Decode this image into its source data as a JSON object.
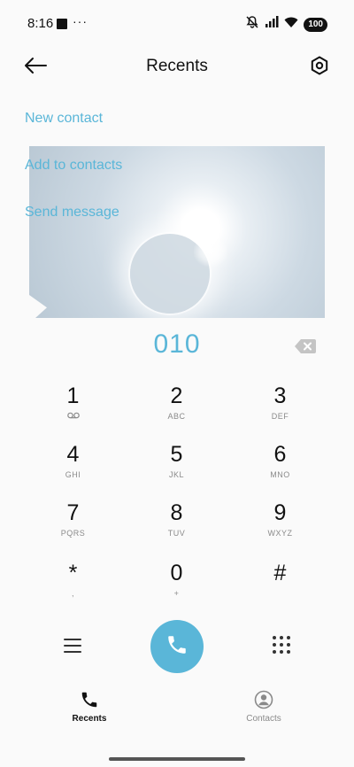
{
  "status_bar": {
    "time": "8:16",
    "dots": "···",
    "battery": "100",
    "icons": [
      "notification-square-icon",
      "mute-vibrate-icon",
      "signal-icon",
      "wifi-icon",
      "battery-icon"
    ]
  },
  "header": {
    "title": "Recents",
    "icons": [
      "back-arrow-icon",
      "settings-icon"
    ]
  },
  "actions": {
    "new_contact": "New contact",
    "add_to_contacts": "Add to contacts",
    "send_message": "Send message"
  },
  "dialer": {
    "number": "010",
    "keys": [
      {
        "digit": "1",
        "letters": "",
        "extra_icon": "voicemail-icon"
      },
      {
        "digit": "2",
        "letters": "ABC"
      },
      {
        "digit": "3",
        "letters": "DEF"
      },
      {
        "digit": "4",
        "letters": "GHI"
      },
      {
        "digit": "5",
        "letters": "JKL"
      },
      {
        "digit": "6",
        "letters": "MNO"
      },
      {
        "digit": "7",
        "letters": "PQRS"
      },
      {
        "digit": "8",
        "letters": "TUV"
      },
      {
        "digit": "9",
        "letters": "WXYZ"
      },
      {
        "digit": "*",
        "letters": ","
      },
      {
        "digit": "0",
        "letters": "+"
      },
      {
        "digit": "#",
        "letters": ""
      }
    ]
  },
  "nav": {
    "recents": "Recents",
    "contacts": "Contacts"
  },
  "colors": {
    "accent": "#5ab6d8",
    "background": "#fafafa",
    "text": "#111111",
    "secondary": "#8a8a8a"
  }
}
